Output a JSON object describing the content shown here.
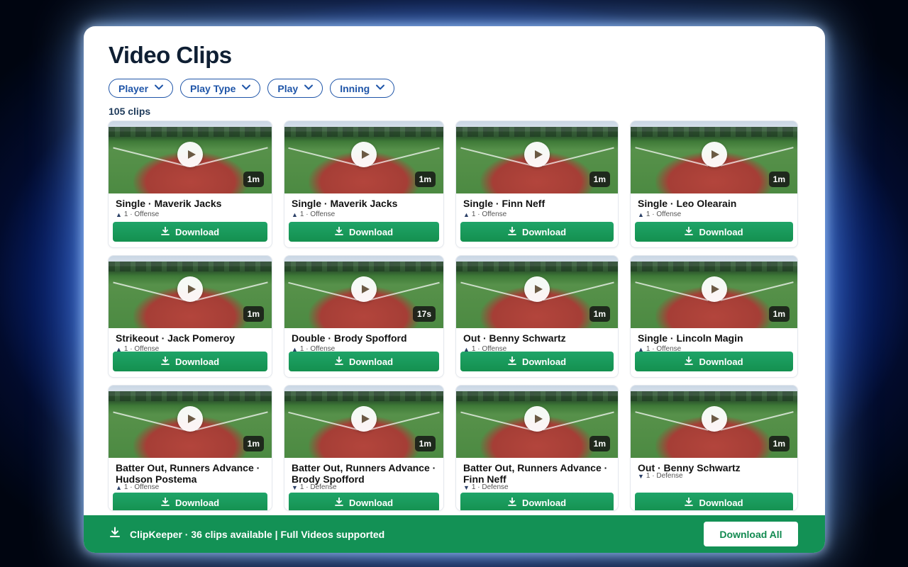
{
  "page": {
    "title": "Video Clips",
    "count": "105 clips"
  },
  "filters": [
    {
      "label": "Player"
    },
    {
      "label": "Play Type"
    },
    {
      "label": "Play"
    },
    {
      "label": "Inning"
    }
  ],
  "download_label": "Download",
  "clips": [
    {
      "title": "Single · Maverik Jacks",
      "duration": "1m",
      "meta": "1 · Offense",
      "arrow": "up"
    },
    {
      "title": "Single · Maverik Jacks",
      "duration": "1m",
      "meta": "1 · Offense",
      "arrow": "up"
    },
    {
      "title": "Single · Finn Neff",
      "duration": "1m",
      "meta": "1 · Offense",
      "arrow": "up"
    },
    {
      "title": "Single · Leo Olearain",
      "duration": "1m",
      "meta": "1 · Offense",
      "arrow": "up"
    },
    {
      "title": "Strikeout · Jack Pomeroy",
      "duration": "1m",
      "meta": "1 · Offense",
      "arrow": "up"
    },
    {
      "title": "Double · Brody Spofford",
      "duration": "17s",
      "meta": "1 · Offense",
      "arrow": "up"
    },
    {
      "title": "Out · Benny Schwartz",
      "duration": "1m",
      "meta": "1 · Offense",
      "arrow": "up"
    },
    {
      "title": "Single · Lincoln Magin",
      "duration": "1m",
      "meta": "1 · Offense",
      "arrow": "up"
    },
    {
      "title": "Batter Out, Runners Advance · Hudson Postema",
      "duration": "1m",
      "meta": "1 · Offense",
      "arrow": "up"
    },
    {
      "title": "Batter Out, Runners Advance · Brody Spofford",
      "duration": "1m",
      "meta": "1 · Defense",
      "arrow": "down"
    },
    {
      "title": "Batter Out, Runners Advance · Finn Neff",
      "duration": "1m",
      "meta": "1 · Defense",
      "arrow": "down"
    },
    {
      "title": "Out · Benny Schwartz",
      "duration": "1m",
      "meta": "1 · Defense",
      "arrow": "down"
    }
  ],
  "footer": {
    "text": "ClipKeeper · 36 clips available | Full Videos supported",
    "button": "Download All"
  },
  "colors": {
    "accent_green": "#139155",
    "filter_blue": "#1f55a8"
  }
}
